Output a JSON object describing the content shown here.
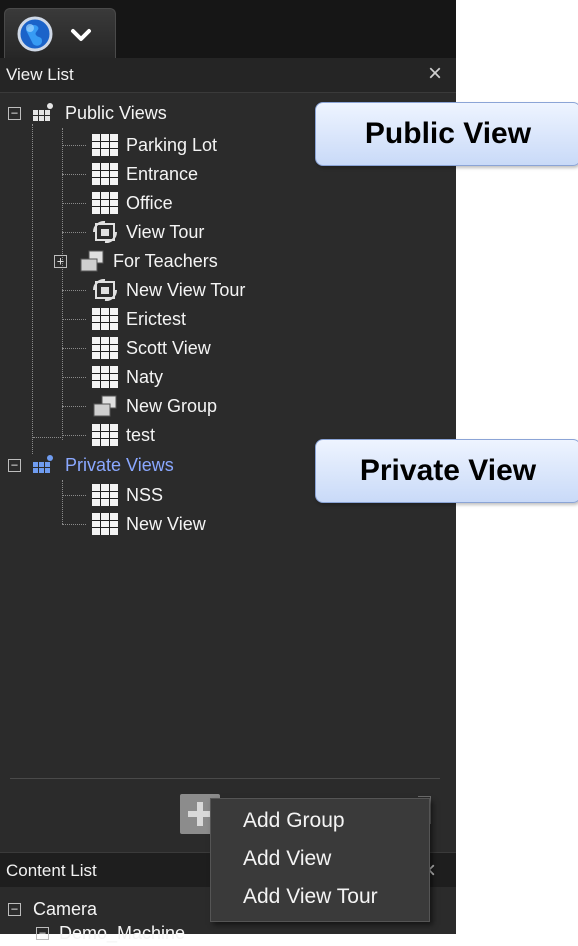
{
  "view_list": {
    "title": "View List",
    "close": "×",
    "public_group": "Public Views",
    "public_items": [
      "Parking Lot",
      "Entrance",
      "Office",
      "View Tour",
      "For Teachers",
      "New View Tour",
      "Erictest",
      "Scott View",
      "Naty",
      "New Group",
      "test"
    ],
    "private_group": "Private Views",
    "private_items": [
      "NSS",
      "New View"
    ]
  },
  "callouts": {
    "public": "Public View",
    "private": "Private View"
  },
  "context_menu": {
    "items": [
      "Add Group",
      "Add View",
      "Add View Tour"
    ]
  },
  "content_list": {
    "title": "Content List",
    "close": "×",
    "camera": "Camera",
    "machine": "Demo_Machine"
  },
  "colors": {
    "panel_bg": "#2b2b2b",
    "private_text": "#8aa8ff",
    "callout_bg": "#dce8fb"
  }
}
